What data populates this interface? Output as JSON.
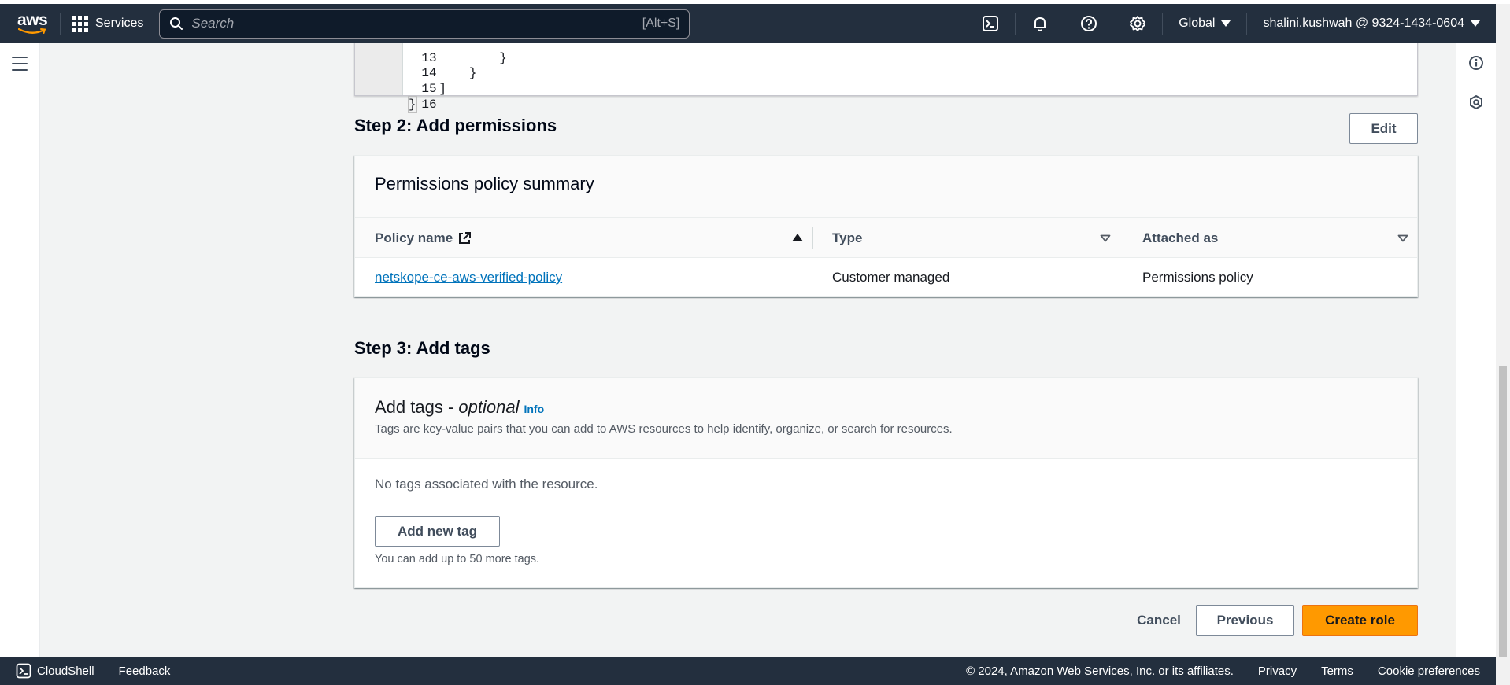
{
  "topnav": {
    "logo_text": "aws",
    "services_label": "Services",
    "search_placeholder": "Search",
    "search_shortcut": "[Alt+S]",
    "region_label": "Global",
    "account_label": "shalini.kushwah @ 9324-1434-0604"
  },
  "code_editor": {
    "lines": [
      {
        "num": "13",
        "text": "            }"
      },
      {
        "num": "14",
        "text": "        }"
      },
      {
        "num": "15",
        "text": "    ]"
      },
      {
        "num": "16",
        "text": "}"
      }
    ]
  },
  "step2": {
    "title": "Step 2: Add permissions",
    "edit_label": "Edit",
    "summary_title": "Permissions policy summary",
    "columns": [
      "Policy name",
      "Type",
      "Attached as"
    ],
    "rows": [
      {
        "policy_name": "netskope-ce-aws-verified-policy",
        "type": "Customer managed",
        "attached_as": "Permissions policy"
      }
    ]
  },
  "step3": {
    "title": "Step 3: Add tags",
    "tags_title": "Add tags - ",
    "tags_title_optional": "optional",
    "info_label": "Info",
    "description": "Tags are key-value pairs that you can add to AWS resources to help identify, organize, or search for resources.",
    "empty_text": "No tags associated with the resource.",
    "add_tag_label": "Add new tag",
    "hint": "You can add up to 50 more tags."
  },
  "actions": {
    "cancel_label": "Cancel",
    "previous_label": "Previous",
    "create_label": "Create role"
  },
  "footer": {
    "cloudshell_label": "CloudShell",
    "feedback_label": "Feedback",
    "copyright": "© 2024, Amazon Web Services, Inc. or its affiliates.",
    "privacy_label": "Privacy",
    "terms_label": "Terms",
    "cookie_label": "Cookie preferences"
  },
  "colors": {
    "nav_bg": "#232f3e",
    "primary_button": "#ff9900",
    "link": "#0073bb",
    "page_bg": "#f2f3f3"
  }
}
